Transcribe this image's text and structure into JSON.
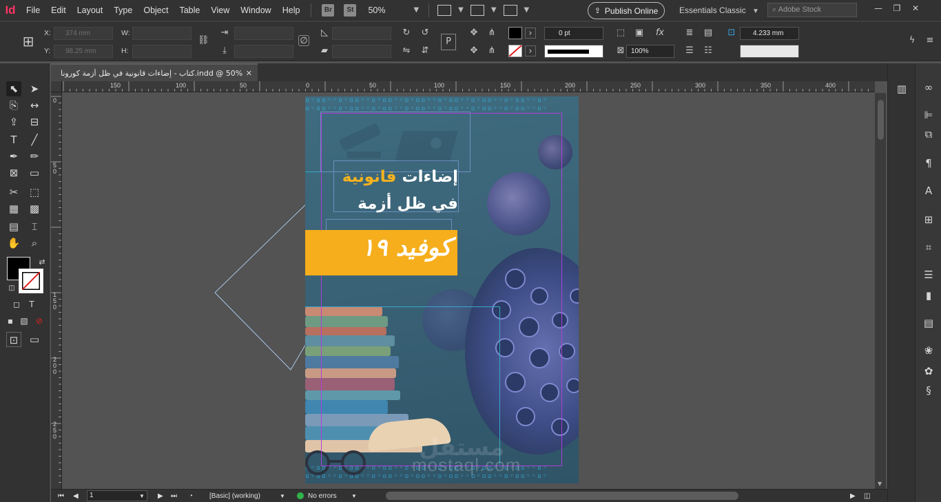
{
  "app": {
    "logo": "Id",
    "menu": [
      "File",
      "Edit",
      "Layout",
      "Type",
      "Object",
      "Table",
      "View",
      "Window",
      "Help"
    ],
    "bridge_label": "Br",
    "stock_label": "St",
    "zoom": "50%",
    "publish_label": "Publish Online",
    "workspace": "Essentials Classic",
    "stock_search_placeholder": "Adobe Stock"
  },
  "control": {
    "x_label": "X:",
    "y_label": "Y:",
    "w_label": "W:",
    "h_label": "H:",
    "x_value": "374 mm",
    "y_value": "98.25 mm",
    "stroke_weight": "0 pt",
    "opacity": "100%",
    "gutter": "4.233 mm"
  },
  "tab": {
    "title": "كتاب - إضاءات قانونية في ظل أزمة كورونا.indd @ 50%",
    "close": "✕"
  },
  "rulers": {
    "top": [
      "150",
      "100",
      "50",
      "0",
      "50",
      "100",
      "150",
      "200",
      "250",
      "300",
      "350",
      "400"
    ],
    "left": [
      "0",
      "50",
      "150",
      "200",
      "250"
    ]
  },
  "document": {
    "title_line1_a": "إضاءات ",
    "title_line1_b": "قانونية",
    "title_line2": "في ظل أزمة",
    "title_line3": "كوفيد ١٩",
    "watermark": "mostaql.com",
    "watermark_ar": "مستقل",
    "strip_pattern": "▫◦▫▫◦◦▫◦▫▫◦◦▫◦▫▫◦◦▫◦▫▫◦◦▫◦▫▫◦◦▫◦▫▫◦◦▫◦▫▫◦◦▫◦"
  },
  "status": {
    "page_number": "1",
    "preflight_profile": "[Basic] (working)",
    "errors": "No errors"
  },
  "colors": {
    "brand": "#ff3366",
    "highlight": "#f5b21e",
    "margin_guide": "#b23cd6",
    "frame": "#6c8fbf",
    "ok_status": "#2fb34a"
  }
}
